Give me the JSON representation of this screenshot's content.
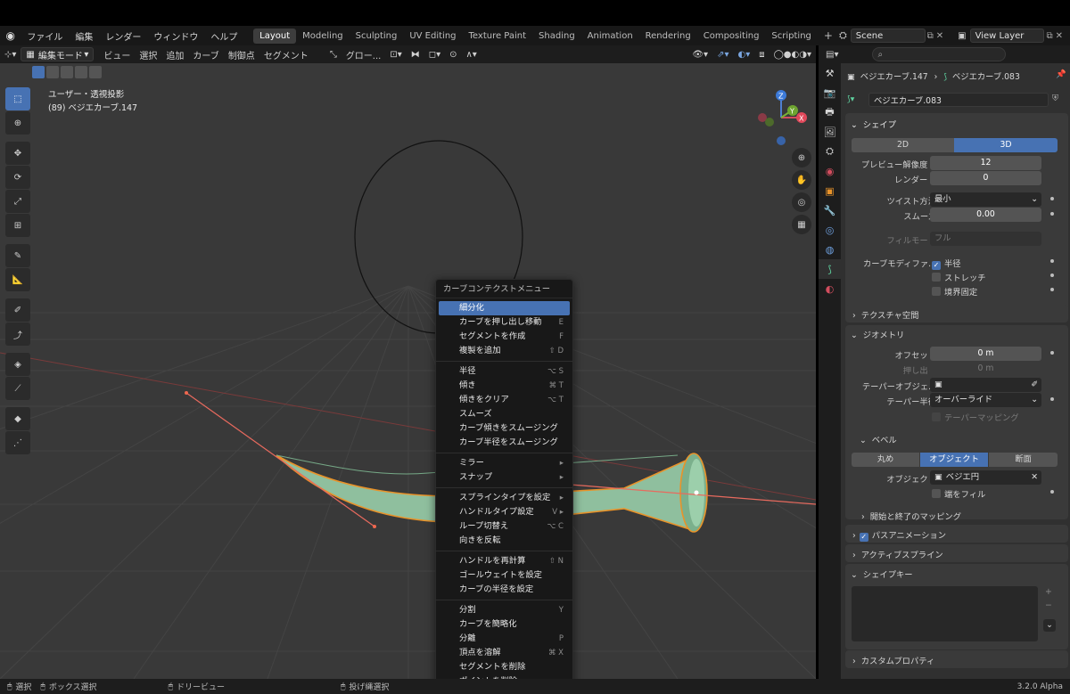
{
  "app": {
    "version": "3.2.0 Alpha"
  },
  "topbar": {
    "menus": [
      "ファイル",
      "編集",
      "レンダー",
      "ウィンドウ",
      "ヘルプ"
    ],
    "workspaces": [
      "Layout",
      "Modeling",
      "Sculpting",
      "UV Editing",
      "Texture Paint",
      "Shading",
      "Animation",
      "Rendering",
      "Compositing",
      "Scripting"
    ],
    "add_tab": "+",
    "scene": "Scene",
    "view_layer": "View Layer"
  },
  "viewport": {
    "mode": "編集モード",
    "menus": [
      "ビュー",
      "選択",
      "追加",
      "カーブ",
      "制御点",
      "セグメント"
    ],
    "transform": "グロー...",
    "view_name": "ユーザー・透視投影",
    "object_info": "(89) ベジエカーブ.147",
    "gizmo": {
      "z": "Z",
      "x": "X",
      "y": "Y"
    }
  },
  "context_menu": {
    "title": "カーブコンテクストメニュー",
    "groups": [
      [
        {
          "label": "細分化",
          "shortcut": ""
        },
        {
          "label": "カーブを押し出し移動",
          "shortcut": "E"
        },
        {
          "label": "セグメントを作成",
          "shortcut": "F"
        },
        {
          "label": "複製を追加",
          "shortcut": "⇧ D"
        }
      ],
      [
        {
          "label": "半径",
          "shortcut": "⌥ S"
        },
        {
          "label": "傾き",
          "shortcut": "⌘ T"
        },
        {
          "label": "傾きをクリア",
          "shortcut": "⌥ T"
        },
        {
          "label": "スムーズ",
          "shortcut": ""
        },
        {
          "label": "カーブ傾きをスムージング",
          "shortcut": ""
        },
        {
          "label": "カーブ半径をスムージング",
          "shortcut": ""
        }
      ],
      [
        {
          "label": "ミラー",
          "shortcut": "▸"
        },
        {
          "label": "スナップ",
          "shortcut": "▸"
        }
      ],
      [
        {
          "label": "スプラインタイプを設定",
          "shortcut": "▸"
        },
        {
          "label": "ハンドルタイプ設定",
          "shortcut": "V ▸"
        },
        {
          "label": "ループ切替え",
          "shortcut": "⌥ C"
        },
        {
          "label": "向きを反転",
          "shortcut": ""
        }
      ],
      [
        {
          "label": "ハンドルを再計算",
          "shortcut": "⇧ N"
        },
        {
          "label": "ゴールウェイトを設定",
          "shortcut": ""
        },
        {
          "label": "カーブの半径を設定",
          "shortcut": ""
        }
      ],
      [
        {
          "label": "分割",
          "shortcut": "Y"
        },
        {
          "label": "カーブを簡略化",
          "shortcut": ""
        },
        {
          "label": "分離",
          "shortcut": "P"
        },
        {
          "label": "頂点を溶解",
          "shortcut": "⌘ X"
        },
        {
          "label": "セグメントを削除",
          "shortcut": ""
        },
        {
          "label": "ポイントを削除",
          "shortcut": ""
        }
      ]
    ]
  },
  "properties": {
    "breadcrumb_obj": "ベジエカーブ.147",
    "breadcrumb_data": "ベジエカーブ.083",
    "datablock": "ベジエカーブ.083",
    "shape": {
      "header": "シェイプ",
      "dim2d": "2D",
      "dim3d": "3D",
      "preview_u_label": "プレビュー解像度 U",
      "preview_u": "12",
      "render_u_label": "レンダー U",
      "render_u": "0",
      "twist_label": "ツイスト方法",
      "twist": "最小",
      "smooth_label": "スムーズ",
      "smooth": "0.00",
      "fill_label": "フィルモード",
      "fill": "フル",
      "deform_label": "カーブモディファ...",
      "radius": "半径",
      "stretch": "ストレッチ",
      "bounds": "境界固定"
    },
    "texspace": "テクスチャ空間",
    "geometry": {
      "header": "ジオメトリ",
      "offset_label": "オフセット",
      "offset": "0 m",
      "extrude_label": "押し出し",
      "extrude": "0 m",
      "taper_obj_label": "テーパーオブジェ...",
      "taper_r_label": "テーパー半径",
      "taper_r": "オーバーライド",
      "taper_map": "テーパーマッピング"
    },
    "bevel": {
      "header": "ベベル",
      "round": "丸め",
      "object": "オブジェクト",
      "profile": "断面",
      "obj_label": "オブジェクト",
      "obj_value": "ベジエ円",
      "fill_caps": "端をフィル",
      "mapping": "開始と終了のマッピング"
    },
    "path_anim": "パスアニメーション",
    "active_spline": "アクティブスプライン",
    "shape_keys": "シェイプキー",
    "custom_props": "カスタムプロパティ"
  },
  "statusbar": {
    "select": "選択",
    "box_select": "ボックス選択",
    "dolly": "ドリービュー",
    "lasso": "投げ縄選択",
    "version": "3.2.0 Alpha"
  }
}
